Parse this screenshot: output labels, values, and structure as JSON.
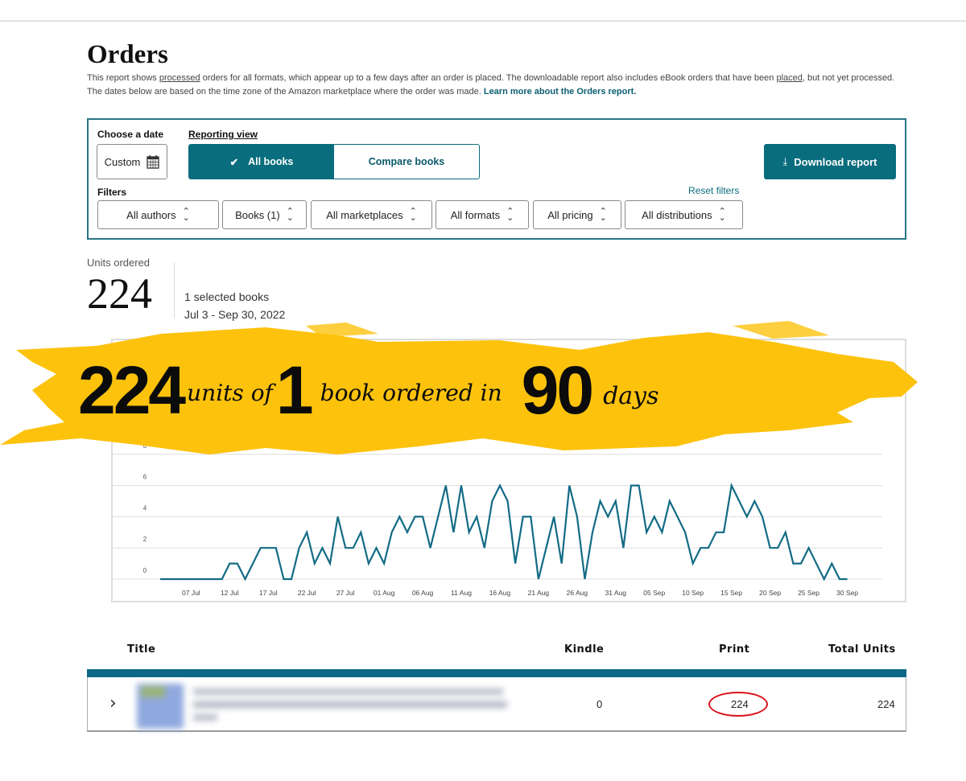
{
  "header": {
    "title": "Orders",
    "desc_1": "This report shows ",
    "desc_link_processed": "processed",
    "desc_2": " orders for all formats, which appear up to a few days after an order is placed. The downloadable report also includes eBook orders that have been ",
    "desc_link_placed": "placed",
    "desc_3": ", but not yet processed. The dates below are based on the time zone of the Amazon marketplace where the order was made.  ",
    "learn_more": "Learn more about the Orders report."
  },
  "controls": {
    "choose_date_label": "Choose a date",
    "date_value": "Custom",
    "reporting_view_label": "Reporting view",
    "all_books": "All books",
    "compare_books": "Compare books",
    "download": "Download report",
    "filters_label": "Filters",
    "reset_filters": "Reset filters",
    "filters": [
      "All authors",
      "Books (1)",
      "All marketplaces",
      "All formats",
      "All pricing",
      "All distributions"
    ]
  },
  "summary": {
    "units_label": "Units ordered",
    "units_value": "224",
    "selected": "1 selected books",
    "date_range": "Jul 3 - Sep 30, 2022"
  },
  "banner": {
    "num1": "224",
    "text1": "units of",
    "num2": "1",
    "text2": "book ordered in",
    "num3": "90",
    "text3": "days",
    "color": "#fdc20c"
  },
  "chart_data": {
    "type": "line",
    "title": "",
    "xlabel": "",
    "ylabel": "",
    "ylim": [
      0,
      8
    ],
    "yticks": [
      "0",
      "2",
      "4",
      "6",
      "8"
    ],
    "grid": true,
    "line_color": "#136b85",
    "xticks": [
      "07 Jul",
      "12 Jul",
      "17 Jul",
      "22 Jul",
      "27 Jul",
      "01 Aug",
      "06 Aug",
      "11 Aug",
      "16 Aug",
      "21 Aug",
      "26 Aug",
      "31 Aug",
      "05 Sep",
      "10 Sep",
      "15 Sep",
      "20 Sep",
      "25 Sep",
      "30 Sep"
    ],
    "xtick_dates": [
      "2022-07-07",
      "2022-07-12",
      "2022-07-17",
      "2022-07-22",
      "2022-07-27",
      "2022-08-01",
      "2022-08-06",
      "2022-08-11",
      "2022-08-16",
      "2022-08-21",
      "2022-08-26",
      "2022-08-31",
      "2022-09-05",
      "2022-09-10",
      "2022-09-15",
      "2022-09-20",
      "2022-09-25",
      "2022-09-30"
    ],
    "x": [
      "2022-07-03",
      "2022-07-04",
      "2022-07-05",
      "2022-07-06",
      "2022-07-07",
      "2022-07-08",
      "2022-07-09",
      "2022-07-10",
      "2022-07-11",
      "2022-07-12",
      "2022-07-13",
      "2022-07-14",
      "2022-07-15",
      "2022-07-16",
      "2022-07-17",
      "2022-07-18",
      "2022-07-19",
      "2022-07-20",
      "2022-07-21",
      "2022-07-22",
      "2022-07-23",
      "2022-07-24",
      "2022-07-25",
      "2022-07-26",
      "2022-07-27",
      "2022-07-28",
      "2022-07-29",
      "2022-07-30",
      "2022-07-31",
      "2022-08-01",
      "2022-08-02",
      "2022-08-03",
      "2022-08-04",
      "2022-08-05",
      "2022-08-06",
      "2022-08-07",
      "2022-08-08",
      "2022-08-09",
      "2022-08-10",
      "2022-08-11",
      "2022-08-12",
      "2022-08-13",
      "2022-08-14",
      "2022-08-15",
      "2022-08-16",
      "2022-08-17",
      "2022-08-18",
      "2022-08-19",
      "2022-08-20",
      "2022-08-21",
      "2022-08-22",
      "2022-08-23",
      "2022-08-24",
      "2022-08-25",
      "2022-08-26",
      "2022-08-27",
      "2022-08-28",
      "2022-08-29",
      "2022-08-30",
      "2022-08-31",
      "2022-09-01",
      "2022-09-02",
      "2022-09-03",
      "2022-09-04",
      "2022-09-05",
      "2022-09-06",
      "2022-09-07",
      "2022-09-08",
      "2022-09-09",
      "2022-09-10",
      "2022-09-11",
      "2022-09-12",
      "2022-09-13",
      "2022-09-14",
      "2022-09-15",
      "2022-09-16",
      "2022-09-17",
      "2022-09-18",
      "2022-09-19",
      "2022-09-20",
      "2022-09-21",
      "2022-09-22",
      "2022-09-23",
      "2022-09-24",
      "2022-09-25",
      "2022-09-26",
      "2022-09-27",
      "2022-09-28",
      "2022-09-29",
      "2022-09-30"
    ],
    "values": [
      0,
      0,
      0,
      0,
      0,
      0,
      0,
      0,
      0,
      1,
      1,
      0,
      1,
      2,
      2,
      2,
      0,
      0,
      2,
      3,
      1,
      2,
      1,
      4,
      2,
      2,
      3,
      1,
      2,
      1,
      3,
      4,
      3,
      4,
      4,
      2,
      4,
      6,
      3,
      6,
      3,
      4,
      2,
      5,
      6,
      5,
      1,
      4,
      4,
      0,
      2,
      4,
      1,
      6,
      4,
      0,
      3,
      5,
      4,
      5,
      2,
      6,
      6,
      3,
      4,
      3,
      5,
      4,
      3,
      1,
      2,
      2,
      3,
      3,
      6,
      5,
      4,
      5,
      4,
      2,
      2,
      3,
      1,
      1,
      2,
      1,
      0,
      1,
      0,
      0
    ]
  },
  "table": {
    "headers": {
      "title": "Title",
      "kindle": "Kindle",
      "print": "Print",
      "total": "Total Units"
    },
    "rows": [
      {
        "kindle": "0",
        "print": "224",
        "total": "224"
      }
    ],
    "highlight_color": "#d9141b"
  }
}
